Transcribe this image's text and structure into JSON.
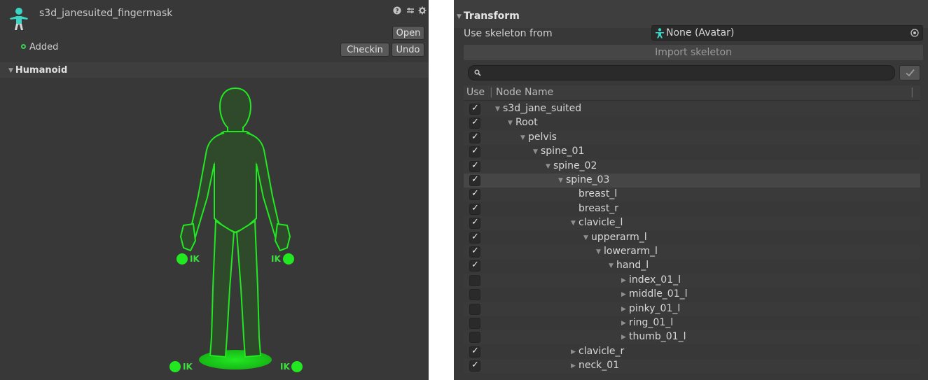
{
  "inspector": {
    "asset_name": "s3d_janesuited_fingermask",
    "open_label": "Open",
    "checkin_label": "Checkin",
    "undo_label": "Undo",
    "status_added": "Added",
    "section_humanoid": "Humanoid",
    "ik_labels": [
      "IK",
      "IK",
      "IK",
      "IK"
    ],
    "icon_help": "help-icon",
    "icon_preset": "preset-icon",
    "icon_settings": "gear-icon"
  },
  "transform": {
    "section_title": "Transform",
    "use_skeleton_label": "Use skeleton from",
    "skeleton_value": "None (Avatar)",
    "import_label": "Import skeleton",
    "search_placeholder": "",
    "col_use": "Use",
    "col_node": "Node Name",
    "nodes": [
      {
        "name": "s3d_jane_suited",
        "depth": 0,
        "arrow": "down",
        "checked": true
      },
      {
        "name": "Root",
        "depth": 1,
        "arrow": "down",
        "checked": true
      },
      {
        "name": "pelvis",
        "depth": 2,
        "arrow": "down",
        "checked": true
      },
      {
        "name": "spine_01",
        "depth": 3,
        "arrow": "down",
        "checked": true
      },
      {
        "name": "spine_02",
        "depth": 4,
        "arrow": "down",
        "checked": true
      },
      {
        "name": "spine_03",
        "depth": 5,
        "arrow": "down",
        "checked": true,
        "selected": true
      },
      {
        "name": "breast_l",
        "depth": 6,
        "arrow": "none",
        "checked": true
      },
      {
        "name": "breast_r",
        "depth": 6,
        "arrow": "none",
        "checked": true
      },
      {
        "name": "clavicle_l",
        "depth": 6,
        "arrow": "down",
        "checked": true
      },
      {
        "name": "upperarm_l",
        "depth": 7,
        "arrow": "down",
        "checked": true
      },
      {
        "name": "lowerarm_l",
        "depth": 8,
        "arrow": "down",
        "checked": true
      },
      {
        "name": "hand_l",
        "depth": 9,
        "arrow": "down",
        "checked": true
      },
      {
        "name": "index_01_l",
        "depth": 10,
        "arrow": "right",
        "checked": false
      },
      {
        "name": "middle_01_l",
        "depth": 10,
        "arrow": "right",
        "checked": false
      },
      {
        "name": "pinky_01_l",
        "depth": 10,
        "arrow": "right",
        "checked": false
      },
      {
        "name": "ring_01_l",
        "depth": 10,
        "arrow": "right",
        "checked": false
      },
      {
        "name": "thumb_01_l",
        "depth": 10,
        "arrow": "right",
        "checked": false
      },
      {
        "name": "clavicle_r",
        "depth": 6,
        "arrow": "right",
        "checked": true
      },
      {
        "name": "neck_01",
        "depth": 6,
        "arrow": "right",
        "checked": true
      }
    ]
  },
  "colors": {
    "panel_bg": "#383838",
    "avatar_green": "#22e822",
    "avatar_fill": "#2f4a2a",
    "added_green": "#3bd15a",
    "skeleton_icon": "#3ad6c5"
  }
}
